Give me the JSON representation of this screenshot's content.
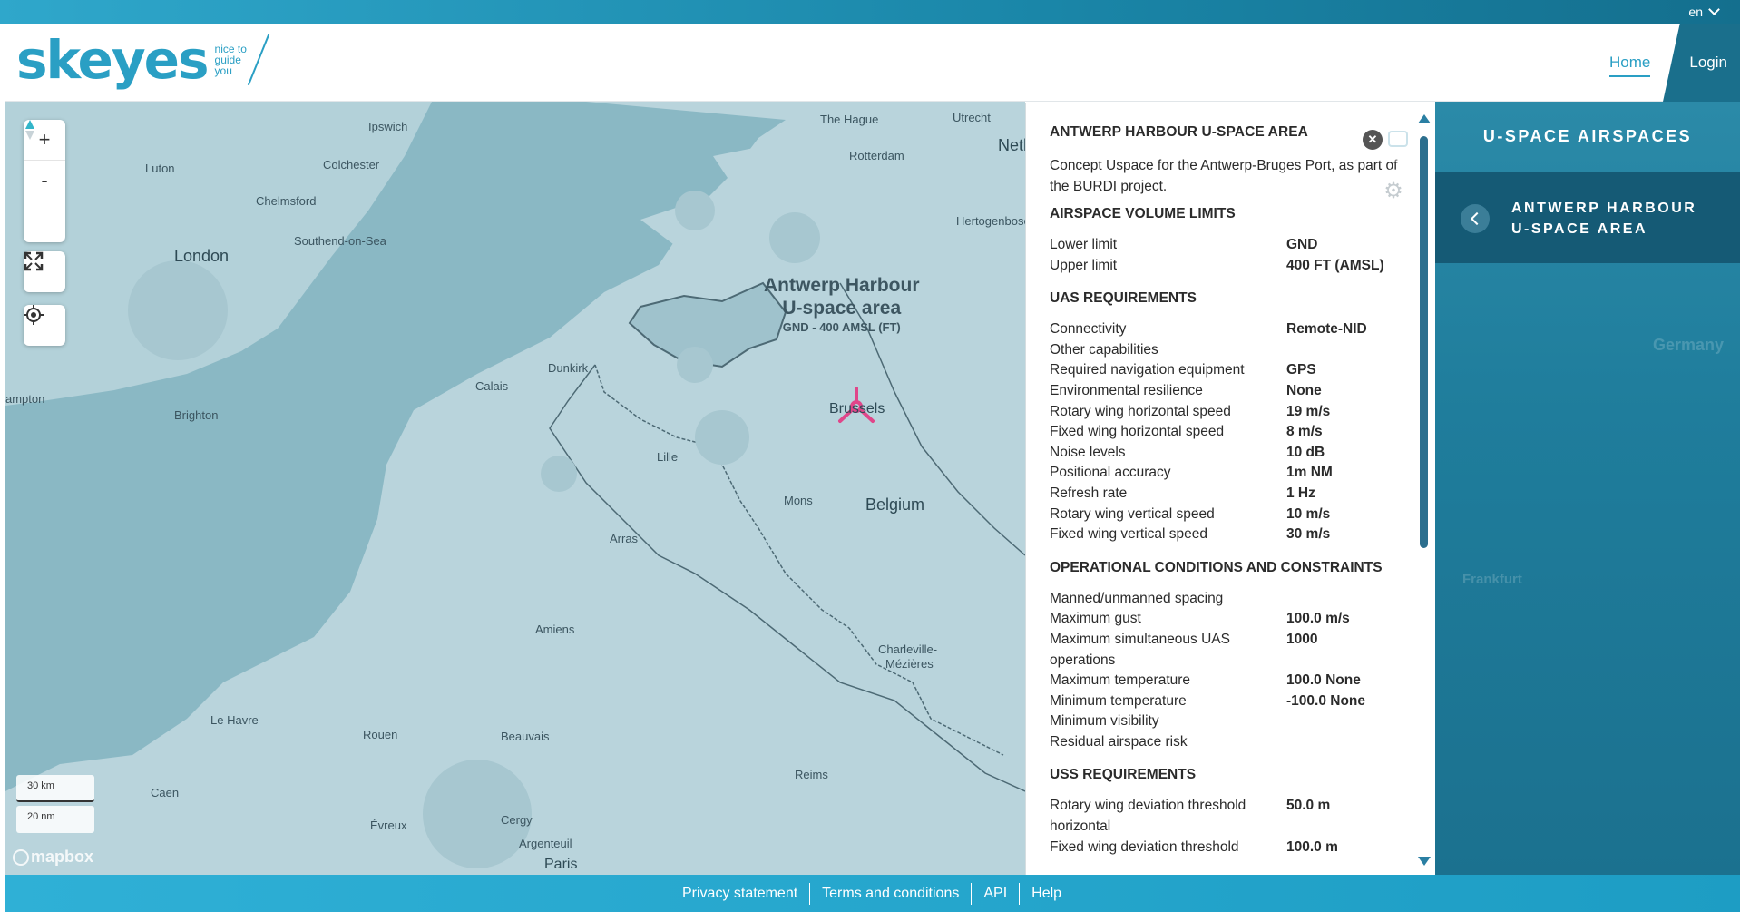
{
  "topbar": {
    "language": "en"
  },
  "header": {
    "logo_text": "skeyes",
    "logo_tagline": [
      "nice to",
      "guide",
      "you"
    ],
    "nav_home": "Home",
    "nav_login": "Login"
  },
  "map": {
    "controls": {
      "zoom_in": "+",
      "zoom_out": "-"
    },
    "scale": {
      "metric": "30 km",
      "imperial": "20 nm"
    },
    "attribution": "mapbox",
    "area_label": {
      "line1": "Antwerp Harbour",
      "line2": "U-space area",
      "limits": "GND - 400 AMSL (FT)"
    },
    "places": [
      {
        "name": "Ipswich",
        "size": "small"
      },
      {
        "name": "Luton",
        "size": "small"
      },
      {
        "name": "Colchester",
        "size": "small"
      },
      {
        "name": "Chelmsford",
        "size": "small"
      },
      {
        "name": "London",
        "size": "big"
      },
      {
        "name": "Southend-on-Sea",
        "size": "small"
      },
      {
        "name": "The Hague",
        "size": "small"
      },
      {
        "name": "Utrecht",
        "size": "small"
      },
      {
        "name": "Netherlands",
        "size": "big"
      },
      {
        "name": "Rotterdam",
        "size": "small"
      },
      {
        "name": "Hertogenbosch",
        "size": "small"
      },
      {
        "name": "Dunkirk",
        "size": "small"
      },
      {
        "name": "Calais",
        "size": "small"
      },
      {
        "name": "Brighton",
        "size": "small"
      },
      {
        "name": "ampton",
        "size": "small"
      },
      {
        "name": "Brussels",
        "size": "mid"
      },
      {
        "name": "Lille",
        "size": "small"
      },
      {
        "name": "Mons",
        "size": "small"
      },
      {
        "name": "Belgium",
        "size": "big"
      },
      {
        "name": "Arras",
        "size": "small"
      },
      {
        "name": "Amiens",
        "size": "small"
      },
      {
        "name": "Charleville-",
        "size": "small"
      },
      {
        "name": "Mézières",
        "size": "small"
      },
      {
        "name": "Le Havre",
        "size": "small"
      },
      {
        "name": "Rouen",
        "size": "small"
      },
      {
        "name": "Beauvais",
        "size": "small"
      },
      {
        "name": "Reims",
        "size": "small"
      },
      {
        "name": "Caen",
        "size": "small"
      },
      {
        "name": "Évreux",
        "size": "small"
      },
      {
        "name": "Cergy",
        "size": "small"
      },
      {
        "name": "Argenteuil",
        "size": "small"
      },
      {
        "name": "Paris",
        "size": "mid"
      }
    ]
  },
  "panel": {
    "title": "ANTWERP HARBOUR U-SPACE AREA",
    "description": "Concept Uspace for the Antwerp-Bruges Port, as part of the BURDI project.",
    "sections": [
      {
        "heading": "AIRSPACE VOLUME LIMITS",
        "rows": [
          {
            "key": "Lower limit",
            "value": "GND"
          },
          {
            "key": "Upper limit",
            "value": "400 FT (AMSL)"
          }
        ]
      },
      {
        "heading": "UAS REQUIREMENTS",
        "rows": [
          {
            "key": "Connectivity",
            "value": "Remote-NID"
          },
          {
            "key": "Other capabilities",
            "value": ""
          },
          {
            "key": "Required navigation equipment",
            "value": "GPS"
          },
          {
            "key": "Environmental resilience",
            "value": "None"
          },
          {
            "key": "Rotary wing horizontal speed",
            "value": "19 m/s"
          },
          {
            "key": "Fixed wing horizontal speed",
            "value": "8 m/s"
          },
          {
            "key": "Noise levels",
            "value": "10 dB"
          },
          {
            "key": "Positional accuracy",
            "value": "1m NM"
          },
          {
            "key": "Refresh rate",
            "value": "1 Hz"
          },
          {
            "key": "Rotary wing vertical speed",
            "value": "10 m/s"
          },
          {
            "key": "Fixed wing vertical speed",
            "value": "30 m/s"
          }
        ]
      },
      {
        "heading": "OPERATIONAL CONDITIONS AND CONSTRAINTS",
        "rows": [
          {
            "key": "Manned/unmanned spacing",
            "value": ""
          },
          {
            "key": "Maximum gust",
            "value": "100.0 m/s"
          },
          {
            "key": "Maximum simultaneous UAS operations",
            "value": "1000"
          },
          {
            "key": "Maximum temperature",
            "value": "100.0 None"
          },
          {
            "key": "Minimum temperature",
            "value": "-100.0 None"
          },
          {
            "key": "Minimum visibility",
            "value": ""
          },
          {
            "key": "Residual airspace risk",
            "value": ""
          }
        ]
      },
      {
        "heading": "USS REQUIREMENTS",
        "rows": [
          {
            "key": "Rotary wing deviation threshold horizontal",
            "value": "50.0 m"
          },
          {
            "key": "Fixed wing deviation threshold",
            "value": "100.0 m"
          }
        ]
      }
    ]
  },
  "sidebar": {
    "title": "U-SPACE AIRSPACES",
    "selected_item": "ANTWERP HARBOUR U-SPACE AREA",
    "background_labels": [
      "Germany",
      "Frankfurt"
    ]
  },
  "footer": {
    "links": [
      "Privacy statement",
      "Terms and conditions",
      "API",
      "Help"
    ]
  },
  "colors": {
    "brand": "#2a9fc4",
    "sidebar": "#1f7d9c",
    "sidebar_selected": "#155a75",
    "footer": "#1d9dc4",
    "area_marker": "#e0468a"
  }
}
